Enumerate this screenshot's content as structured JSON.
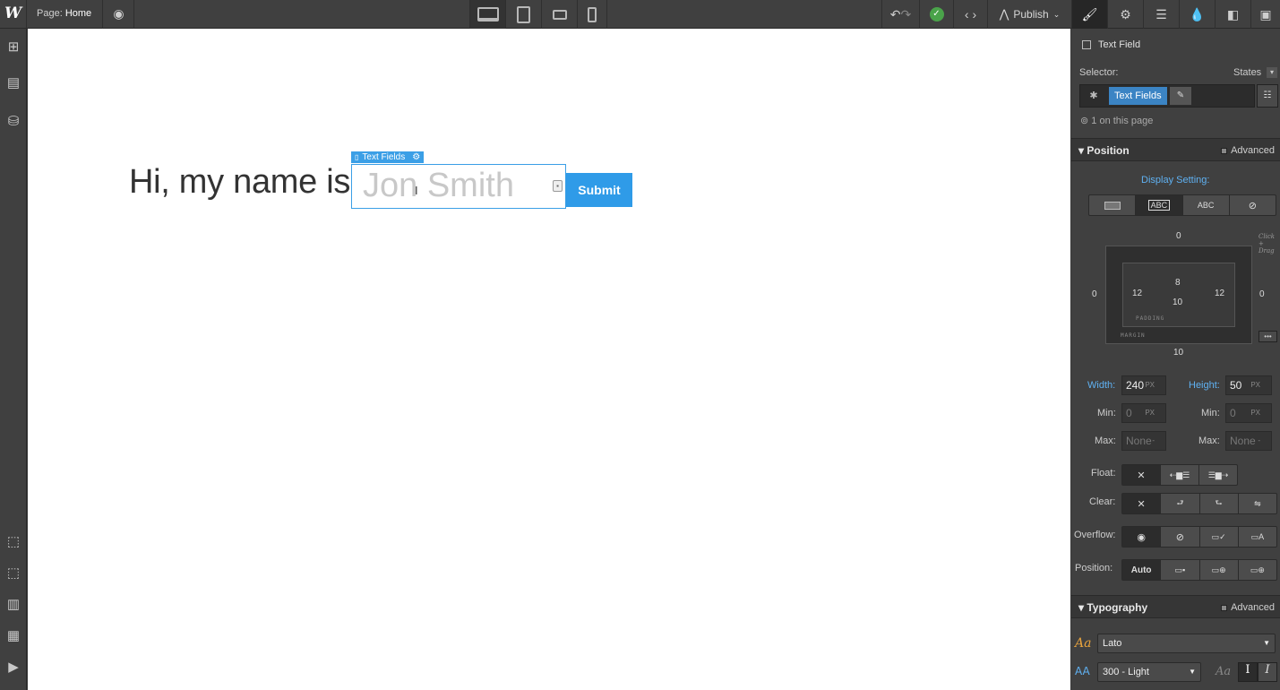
{
  "topbar": {
    "logo": "W",
    "page_prefix": "Page:",
    "page_name": "Home",
    "publish_label": "Publish"
  },
  "canvas": {
    "heading": "Hi, my name is",
    "selection_tag": "Text Fields",
    "field_placeholder": "Jon Smith",
    "submit_label": "Submit"
  },
  "style_panel": {
    "element_type": "Text Field",
    "selector_label": "Selector:",
    "states_label": "States",
    "selector_class": "Text Fields",
    "on_page": "1 on this page",
    "position_section": "Position",
    "advanced_label": "Advanced",
    "display_setting_label": "Display Setting:",
    "display_options": [
      "",
      "ABC",
      "ABC",
      ""
    ],
    "box_model": {
      "margin_top": "0",
      "margin_right": "0",
      "margin_bottom": "10",
      "margin_left": "0",
      "padding_top": "8",
      "padding_right": "12",
      "padding_bottom": "10",
      "padding_left": "12",
      "padding_label": "PADDING",
      "margin_label": "MARGIN",
      "hint": "Click + Drag"
    },
    "width_label": "Width:",
    "width_value": "240",
    "height_label": "Height:",
    "height_value": "50",
    "unit": "PX",
    "min_label": "Min:",
    "min_value": "0",
    "max_label": "Max:",
    "max_value": "None",
    "max_unit": "-",
    "float_label": "Float:",
    "clear_label": "Clear:",
    "overflow_label": "Overflow:",
    "position_label": "Position:",
    "position_auto": "Auto",
    "none_symbol": "✕",
    "typography_section": "Typography",
    "font_family": "Lato",
    "font_weight": "300 - Light"
  }
}
